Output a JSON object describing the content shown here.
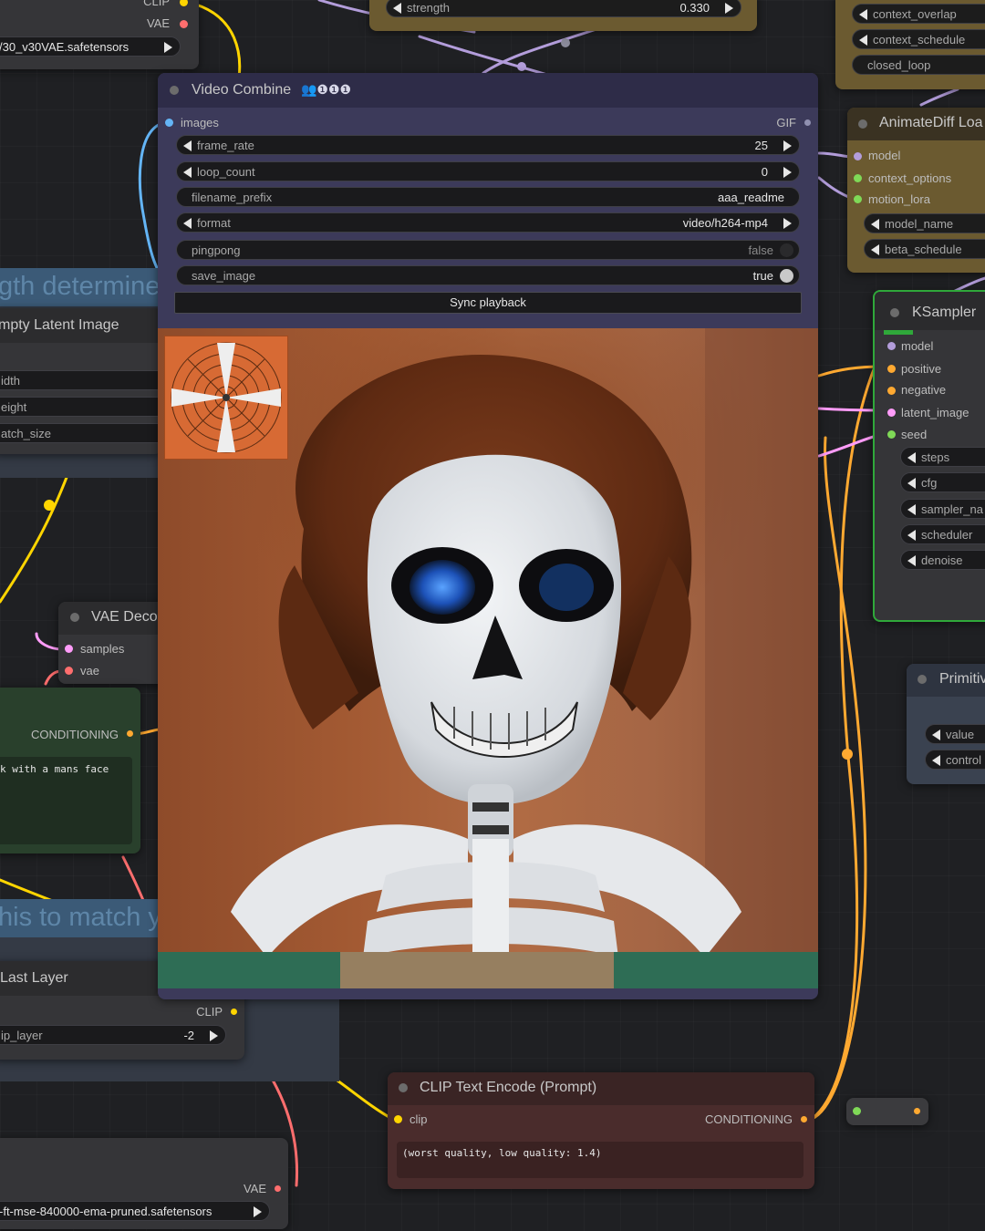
{
  "video_combine": {
    "title": "Video Combine",
    "title_icons": "👥❶❶❶",
    "input_images": "images",
    "output_gif": "GIF",
    "widgets": {
      "frame_rate": {
        "name": "frame_rate",
        "value": "25"
      },
      "loop_count": {
        "name": "loop_count",
        "value": "0"
      },
      "filename_prefix": {
        "name": "filename_prefix",
        "value": "aaa_readme"
      },
      "format": {
        "name": "format",
        "value": "video/h264-mp4"
      },
      "pingpong": {
        "name": "pingpong",
        "value": "false"
      },
      "save_image": {
        "name": "save_image",
        "value": "true"
      }
    },
    "sync_button": "Sync playback"
  },
  "top_left_node": {
    "clip_output": "CLIP",
    "vae_output": "VAE",
    "ckpt_value": "/30_v30VAE.safetensors"
  },
  "strength_widget": {
    "name": "strength",
    "value": "0.330"
  },
  "context_options": {
    "items": [
      "context_overlap",
      "context_schedule",
      "closed_loop"
    ]
  },
  "animatediff": {
    "title": "AnimateDiff Loa",
    "inputs": [
      "model",
      "context_options",
      "motion_lora"
    ],
    "widgets": [
      "model_name",
      "beta_schedule"
    ]
  },
  "ksampler": {
    "title": "KSampler",
    "inputs": [
      "model",
      "positive",
      "negative",
      "latent_image",
      "seed"
    ],
    "widgets": [
      "steps",
      "cfg",
      "sampler_na",
      "scheduler",
      "denoise"
    ]
  },
  "primitive": {
    "title": "Primitiv",
    "widgets": [
      "value",
      "control"
    ]
  },
  "left_group_title": "gth determined",
  "empty_latent": {
    "title": "mpty Latent Image",
    "widgets": [
      "idth",
      "eight",
      "atch_size"
    ]
  },
  "vae_decode": {
    "title": "VAE Deco",
    "inputs": [
      "samples",
      "vae"
    ]
  },
  "conditioning_node": {
    "output": "CONDITIONING",
    "text": "k with a mans face"
  },
  "left_group_title_2": "his to match y",
  "clip_set_last_layer": {
    "title": "Last Layer",
    "output": "CLIP",
    "widget": {
      "name": "ip_layer",
      "value": "-2"
    }
  },
  "vae_loader": {
    "output": "VAE",
    "value": "-ft-mse-840000-ema-pruned.safetensors"
  },
  "clip_text_encode": {
    "title": "CLIP Text Encode (Prompt)",
    "input": "clip",
    "output": "CONDITIONING",
    "text": "(worst quality, low quality: 1.4)"
  },
  "colors": {
    "clip": "#ffd500",
    "vae": "#ff6e6e",
    "latent": "#ff9cf9",
    "model": "#b39ddb",
    "conditioning": "#ffa931",
    "image": "#64b5f6",
    "int": "#7fd957"
  }
}
